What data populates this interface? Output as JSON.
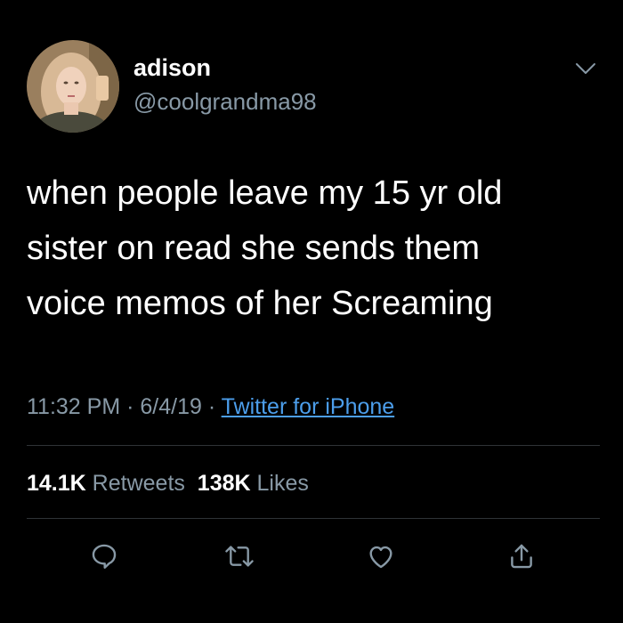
{
  "tweet": {
    "author": {
      "display_name": "adison",
      "handle": "@coolgrandma98"
    },
    "text_lines": [
      "when people leave my 15 yr old",
      "sister on read she sends them",
      "voice memos of her Screaming"
    ],
    "time": "11:32 PM",
    "date": "6/4/19",
    "separator": " · ",
    "source": "Twitter for iPhone",
    "stats": {
      "retweets_count": "14.1K",
      "retweets_label": "Retweets",
      "likes_count": "138K",
      "likes_label": "Likes"
    }
  },
  "icons": {
    "more_menu": "chevron-down-icon",
    "reply": "reply-icon",
    "retweet": "retweet-icon",
    "like": "heart-icon",
    "share": "share-icon"
  },
  "colors": {
    "background": "#000000",
    "primary_text": "#ffffff",
    "secondary_text": "#8899a6",
    "link": "#4c9eeb",
    "divider": "#2f3336"
  }
}
